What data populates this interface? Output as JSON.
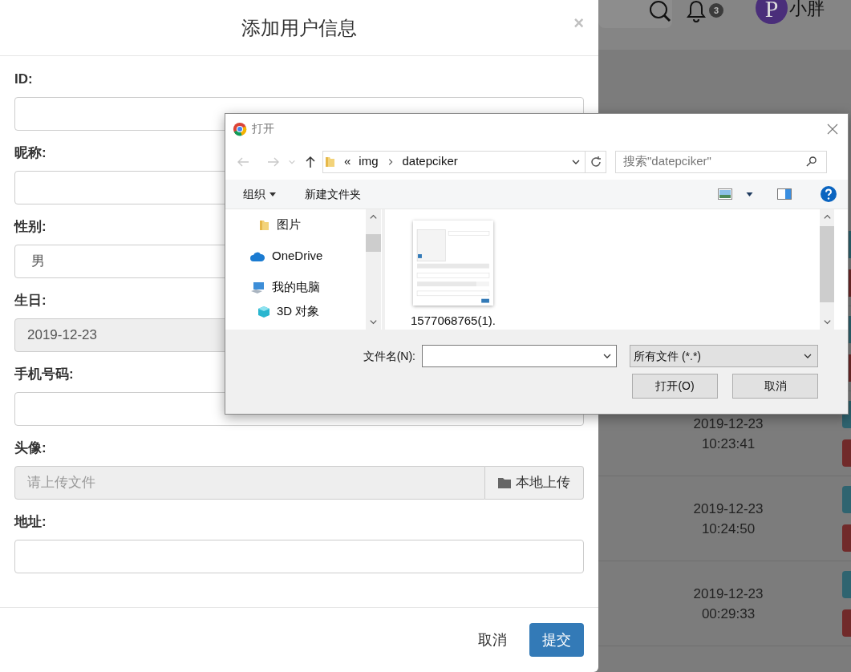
{
  "background_page": {
    "header": {
      "notification_count": "3",
      "avatar_letter": "P",
      "user_name": "小胖"
    },
    "rows": [
      {
        "kind": "covered"
      },
      {
        "kind": "covered"
      },
      {
        "kind": "shown",
        "date": "2019-12-23",
        "time": "10:23:41"
      },
      {
        "kind": "shown",
        "date": "2019-12-23",
        "time": "10:24:50"
      },
      {
        "kind": "shown",
        "date": "2019-12-23",
        "time": "00:29:33"
      }
    ]
  },
  "modal": {
    "title": "添加用户信息",
    "close": "×",
    "fields": [
      {
        "label": "ID:",
        "kind": "text",
        "disabled": false
      },
      {
        "label": "昵称:",
        "kind": "text",
        "disabled": false
      },
      {
        "label": "性别:",
        "kind": "select",
        "value": "男",
        "disabled": false
      },
      {
        "label": "生日:",
        "kind": "text",
        "value": "2019-12-23",
        "disabled": true
      },
      {
        "label": "手机号码:",
        "kind": "text",
        "disabled": false
      },
      {
        "label": "头像:",
        "kind": "file",
        "placeholder": "请上传文件",
        "button": "本地上传",
        "disabled": true
      },
      {
        "label": "地址:",
        "kind": "text",
        "disabled": false
      }
    ],
    "buttons": [
      {
        "label": "取消",
        "kind": "default"
      },
      {
        "label": "提交",
        "kind": "primary"
      }
    ]
  },
  "file_dialog": {
    "title": "打开",
    "path_prefix": "«",
    "path": [
      "img",
      "datepciker"
    ],
    "search_placeholder": "搜索\"datepciker\"",
    "toolbar": [
      {
        "label": "组织",
        "kind": "menu"
      },
      {
        "label": "新建文件夹",
        "kind": "plain"
      }
    ],
    "nav_items": [
      {
        "label": "图片",
        "kind": "folder"
      },
      {
        "label": "OneDrive",
        "kind": "cloud"
      },
      {
        "label": "我的电脑",
        "kind": "computer"
      },
      {
        "label": "3D 对象",
        "kind": "cube"
      }
    ],
    "files": [
      {
        "name": "1577068765(1).",
        "kind": "picture"
      }
    ],
    "filename_label": "文件名(N):",
    "filter": "所有文件 (*.*)",
    "buttons": [
      "打开(O)",
      "取消"
    ]
  }
}
